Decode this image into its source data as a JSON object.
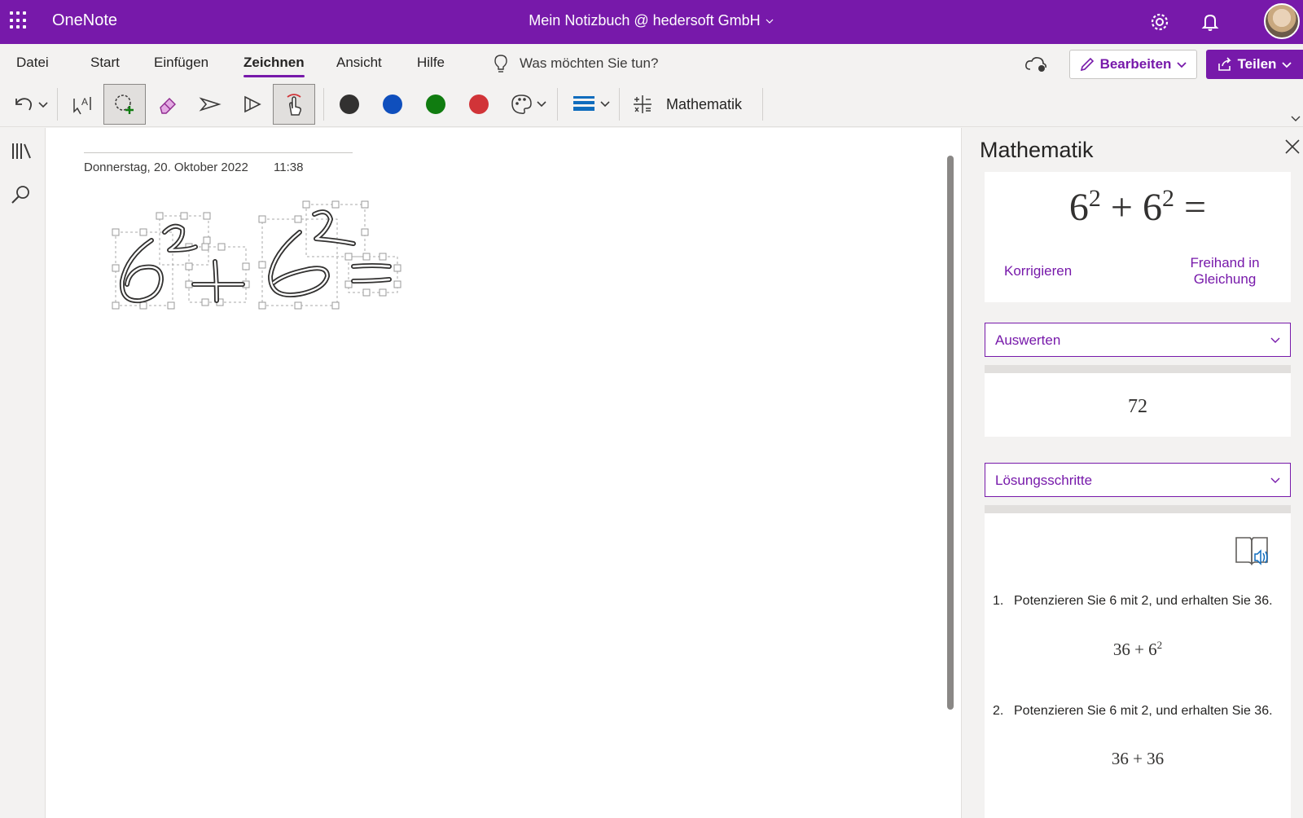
{
  "app": {
    "name": "OneNote",
    "notebook_title": "Mein Notizbuch @ hedersoft GmbH"
  },
  "menu": {
    "tabs": [
      "Datei",
      "Start",
      "Einfügen",
      "Zeichnen",
      "Ansicht",
      "Hilfe"
    ],
    "active_tab": "Zeichnen",
    "tell_me_placeholder": "Was möchten Sie tun?",
    "edit_label": "Bearbeiten",
    "share_label": "Teilen"
  },
  "toolbar": {
    "math_label": "Mathematik",
    "pen_colors": [
      "#323130",
      "#0f4fbd",
      "#107c10",
      "#d13438"
    ],
    "accent": "#7719aa"
  },
  "page": {
    "date": "Donnerstag, 20. Oktober 2022",
    "time": "11:38"
  },
  "math_panel": {
    "title": "Mathematik",
    "equation": {
      "base1": "6",
      "exp1": "2",
      "op": "+",
      "base2": "6",
      "exp2": "2",
      "eq": "="
    },
    "correct_label": "Korrigieren",
    "ink_to_equation_line1": "Freihand in",
    "ink_to_equation_line2": "Gleichung",
    "action_select": "Auswerten",
    "result": "72",
    "steps_select": "Lösungsschritte",
    "steps": [
      {
        "num": "1.",
        "text": "Potenzieren Sie 6 mit 2, und erhalten Sie 36.",
        "eq_main": "36 + 6",
        "eq_exp": "2"
      },
      {
        "num": "2.",
        "text": "Potenzieren Sie 6 mit 2, und erhalten Sie 36.",
        "eq_main": "36 + 36",
        "eq_exp": ""
      }
    ]
  }
}
